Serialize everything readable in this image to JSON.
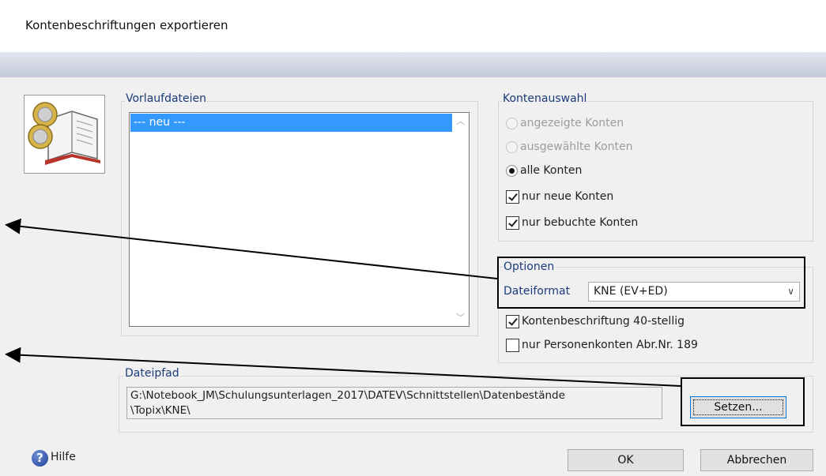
{
  "window": {
    "title": "Kontenbeschriftungen exportieren"
  },
  "vorlauf": {
    "legend": "Vorlaufdateien",
    "items": [
      "--- neu ---"
    ]
  },
  "kontenauswahl": {
    "legend": "Kontenauswahl",
    "radios": [
      {
        "label": "angezeigte Konten",
        "checked": false,
        "disabled": true
      },
      {
        "label": "ausgewählte Konten",
        "checked": false,
        "disabled": true
      },
      {
        "label": "alle Konten",
        "checked": true,
        "disabled": false
      }
    ],
    "checkboxes": [
      {
        "label": "nur neue Konten",
        "checked": true
      },
      {
        "label": "nur bebuchte Konten",
        "checked": true
      }
    ]
  },
  "optionen": {
    "legend": "Optionen",
    "dateiformat_label": "Dateiformat",
    "dateiformat_value": "KNE  (EV+ED)",
    "checkboxes": [
      {
        "label": "Kontenbeschriftung 40-stellig",
        "checked": true
      },
      {
        "label": "nur Personenkonten Abr.Nr. 189",
        "checked": false
      }
    ]
  },
  "dateipfad": {
    "legend": "Dateipfad",
    "line1": "G:\\Notebook_JM\\Schulungsunterlagen_2017\\DATEV\\Schnittstellen\\Datenbestände",
    "line2": "\\Topix\\KNE\\",
    "setzen_label": "Setzen..."
  },
  "footer": {
    "help_label": "Hilfe",
    "ok_label": "OK",
    "cancel_label": "Abbrechen"
  },
  "icons": {
    "app": "coins-book-icon",
    "help": "help-icon",
    "dropdown": "chevron-down-icon"
  }
}
